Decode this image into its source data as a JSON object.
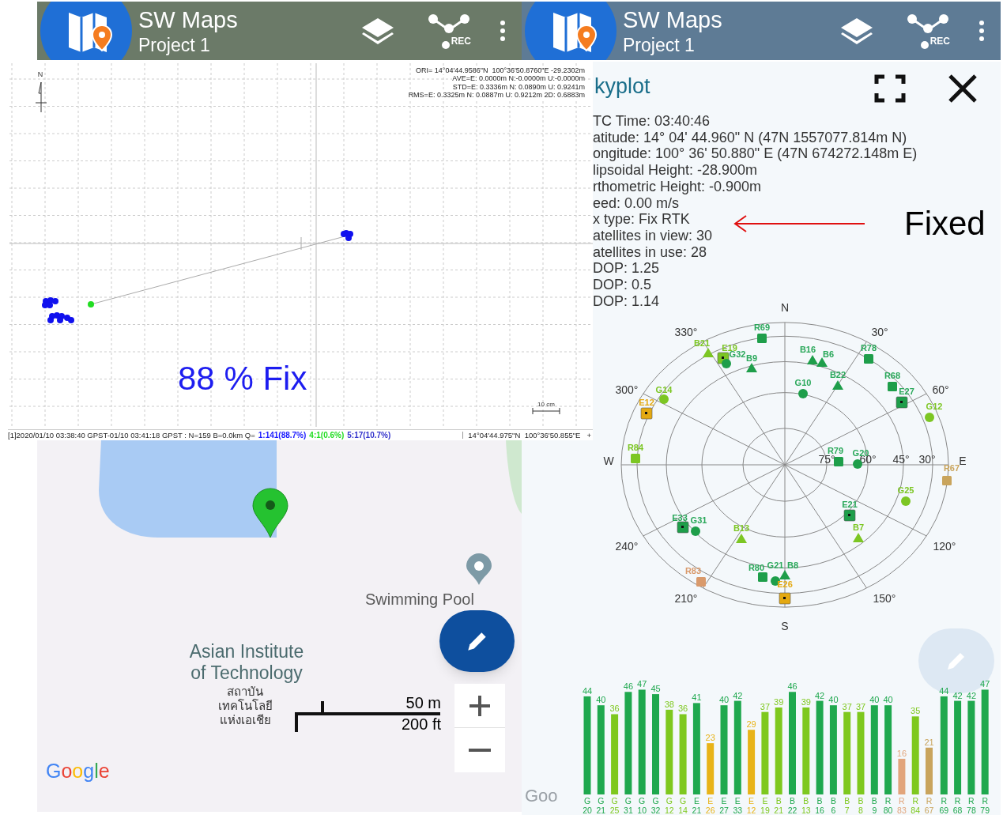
{
  "headers": [
    {
      "title": "SW Maps",
      "subtitle": "Project 1",
      "rec": "REC"
    },
    {
      "title": "SW Maps",
      "subtitle": "Project 1",
      "rec": "REC"
    }
  ],
  "plot": {
    "north": "N",
    "stats": [
      "ORI= 14°04'44.9586\"N  100°36'50.8760\"E -29.2302m",
      "AVE=E: 0.0000m N:-0.0000m U:-0.0000m",
      "STD=E: 0.3336m N: 0.0890m U: 0.9241m",
      "RMS=E: 0.3325m N: 0.0887m U: 0.9212m 2D: 0.6883m"
    ],
    "scale": "10 cm",
    "fix_label": "88 % Fix"
  },
  "status_bar": {
    "text": "[1]2020/01/10 03:38:40 GPST-01/10 03:41:18 GPST : N=159 B=0.0km Q=",
    "q_counts": [
      {
        "text": "1:141(88.7%)",
        "color": "#1a1aff"
      },
      {
        "text": "4:1(0.6%)",
        "color": "#22dd22"
      },
      {
        "text": "5:17(10.7%)",
        "color": "#3333cc"
      }
    ],
    "position": "14°04'44.975\"N  100°36'50.855\"E",
    "plus": "+"
  },
  "map": {
    "place": "Swimming Pool",
    "institute": [
      "Asian Institute",
      "of Technology"
    ],
    "institute_thai": [
      "สถาบัน",
      "เทคโนโลยี",
      "แห่งเอเชีย"
    ],
    "scale_metric": "50 m",
    "scale_imperial": "200 ft",
    "logo": "Google"
  },
  "skyplot": {
    "title": "kyplot",
    "info": [
      "TC Time: 03:40:46",
      "atitude: 14° 04' 44.960\" N (47N 1557077.814m N)",
      "ongitude: 100° 36' 50.880\" E (47N 674272.148m E)",
      "lipsoidal Height: -28.900m",
      "rthometric Height: -0.900m",
      "eed: 0.00 m/s",
      "x type: Fix RTK",
      "atellites in view: 30",
      "atellites in use: 28",
      "DOP: 1.25",
      "DOP: 0.5",
      "DOP: 1.14"
    ],
    "annotation": "Fixed",
    "azimuth_labels": [
      "N",
      "30°",
      "60°",
      "E",
      "120°",
      "150°",
      "S",
      "210°",
      "240°",
      "W",
      "300°",
      "330°"
    ],
    "elevation_labels": [
      "75°",
      "60°",
      "45°",
      "30°"
    ],
    "satellites": [
      {
        "label": "R69",
        "kind": "square",
        "color": "#1e9e4a"
      },
      {
        "label": "B21",
        "kind": "triangle",
        "color": "#7cc623"
      },
      {
        "label": "E19",
        "kind": "flagged",
        "color": "#7cc623"
      },
      {
        "label": "G32",
        "kind": "circle",
        "color": "#1e9e4a"
      },
      {
        "label": "B9",
        "kind": "triangle",
        "color": "#1e9e4a"
      },
      {
        "label": "B16",
        "kind": "triangle",
        "color": "#1e9e4a"
      },
      {
        "label": "B6",
        "kind": "triangle",
        "color": "#1e9e4a"
      },
      {
        "label": "R78",
        "kind": "square",
        "color": "#1e9e4a"
      },
      {
        "label": "G10",
        "kind": "circle",
        "color": "#1e9e4a"
      },
      {
        "label": "B22",
        "kind": "triangle",
        "color": "#1e9e4a"
      },
      {
        "label": "R68",
        "kind": "square",
        "color": "#1e9e4a"
      },
      {
        "label": "E27",
        "kind": "flagged",
        "color": "#1e9e4a"
      },
      {
        "label": "G14",
        "kind": "circle",
        "color": "#7cc623"
      },
      {
        "label": "G12",
        "kind": "circle",
        "color": "#7cc623"
      },
      {
        "label": "E12",
        "kind": "flagged",
        "color": "#e4a912"
      },
      {
        "label": "R84",
        "kind": "square",
        "color": "#7cc623"
      },
      {
        "label": "R79",
        "kind": "square",
        "color": "#1e9e4a"
      },
      {
        "label": "G20",
        "kind": "circle",
        "color": "#1e9e4a"
      },
      {
        "label": "R67",
        "kind": "square",
        "color": "#c9a45c"
      },
      {
        "label": "G25",
        "kind": "circle",
        "color": "#7cc623"
      },
      {
        "label": "E21",
        "kind": "flagged",
        "color": "#1e9e4a"
      },
      {
        "label": "E33",
        "kind": "flagged",
        "color": "#1e9e4a"
      },
      {
        "label": "G31",
        "kind": "circle",
        "color": "#1e9e4a"
      },
      {
        "label": "B13",
        "kind": "triangle",
        "color": "#7cc623"
      },
      {
        "label": "B7",
        "kind": "triangle",
        "color": "#7cc623"
      },
      {
        "label": "R83",
        "kind": "square",
        "color": "#d99a6c"
      },
      {
        "label": "R80",
        "kind": "square",
        "color": "#1e9e4a"
      },
      {
        "label": "G21",
        "kind": "circle",
        "color": "#1e9e4a"
      },
      {
        "label": "B8",
        "kind": "triangle",
        "color": "#1e9e4a"
      },
      {
        "label": "E26",
        "kind": "flagged",
        "color": "#e4a912"
      }
    ],
    "logo": "Goo"
  },
  "signal_chart": {
    "chart_data": {
      "type": "bar",
      "categories": [
        "G 20",
        "G 21",
        "G 25",
        "G 31",
        "G 10",
        "G 32",
        "G 12",
        "G 14",
        "E 21",
        "E 26",
        "E 27",
        "E 33",
        "E 12",
        "E 19",
        "B 21",
        "B 22",
        "B 13",
        "B 16",
        "B 6",
        "B 7",
        "B 8",
        "B 9",
        "R 80",
        "R 83",
        "R 84",
        "R 67",
        "R 69",
        "R 68",
        "R 78",
        "R 79"
      ],
      "values": [
        44,
        40,
        36,
        46,
        47,
        45,
        38,
        36,
        41,
        23,
        40,
        42,
        29,
        37,
        39,
        46,
        39,
        42,
        40,
        37,
        37,
        40,
        40,
        16,
        35,
        21,
        44,
        42,
        42,
        47
      ],
      "data_labels": true
    },
    "bars": [
      {
        "color": "#1fa84e"
      },
      {
        "color": "#1fa84e"
      },
      {
        "color": "#7ec81e"
      },
      {
        "color": "#1fa84e"
      },
      {
        "color": "#1fa84e"
      },
      {
        "color": "#1fa84e"
      },
      {
        "color": "#7ec81e"
      },
      {
        "color": "#7ec81e"
      },
      {
        "color": "#1fa84e"
      },
      {
        "color": "#e8b318"
      },
      {
        "color": "#1fa84e"
      },
      {
        "color": "#1fa84e"
      },
      {
        "color": "#e8b318"
      },
      {
        "color": "#7ec81e"
      },
      {
        "color": "#7ec81e"
      },
      {
        "color": "#1fa84e"
      },
      {
        "color": "#7ec81e"
      },
      {
        "color": "#1fa84e"
      },
      {
        "color": "#1fa84e"
      },
      {
        "color": "#7ec81e"
      },
      {
        "color": "#7ec81e"
      },
      {
        "color": "#1fa84e"
      },
      {
        "color": "#1fa84e"
      },
      {
        "color": "#e2a57c"
      },
      {
        "color": "#7ec81e"
      },
      {
        "color": "#c9a45c"
      },
      {
        "color": "#1fa84e"
      },
      {
        "color": "#1fa84e"
      },
      {
        "color": "#1fa84e"
      },
      {
        "color": "#1fa84e"
      }
    ]
  }
}
